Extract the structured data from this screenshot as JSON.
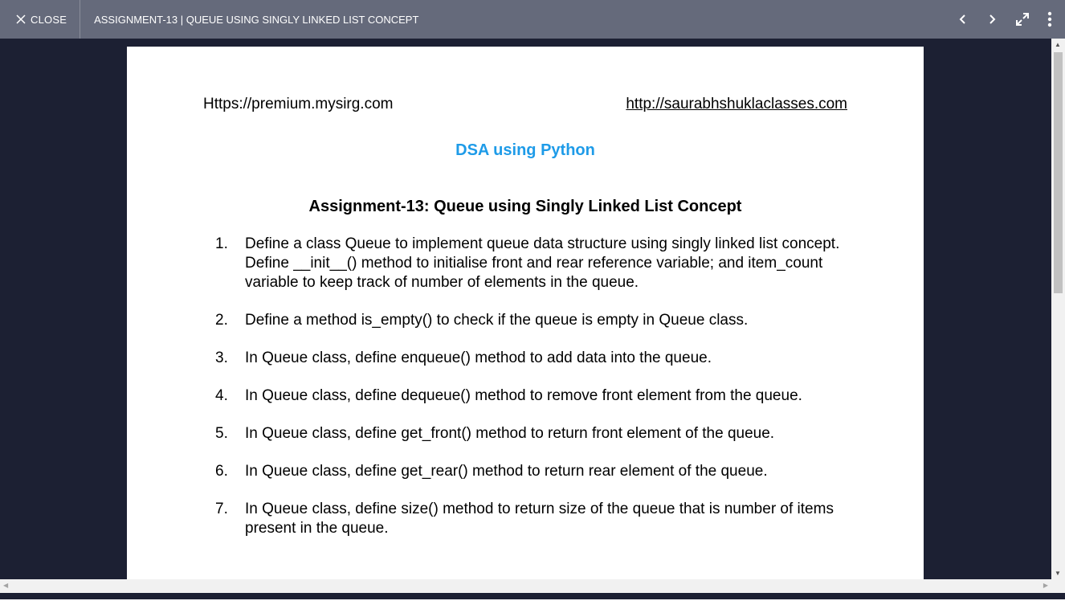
{
  "topbar": {
    "close_label": "CLOSE",
    "title": "ASSIGNMENT-13 | QUEUE USING SINGLY LINKED LIST CONCEPT",
    "icons": [
      "close-icon",
      "chevron-left-icon",
      "chevron-right-icon",
      "expand-icon",
      "more-vert-icon"
    ]
  },
  "document": {
    "header_left": "Https://premium.mysirg.com",
    "header_right": "http://saurabhshuklaclasses.com",
    "course_title": "DSA using Python",
    "assignment_title": "Assignment-13: Queue using Singly Linked List Concept",
    "items": [
      {
        "num": "1.",
        "text": "Define a class Queue to implement queue data structure using singly linked list concept. Define __init__() method to initialise front and rear reference variable; and item_count variable to keep track of number of elements in the queue."
      },
      {
        "num": "2.",
        "text": "Define a method is_empty() to check if the queue is empty in Queue class."
      },
      {
        "num": "3.",
        "text": "In Queue class, define enqueue() method to add data into the queue."
      },
      {
        "num": "4.",
        "text": "In Queue class, define dequeue() method to remove front element from the queue."
      },
      {
        "num": "5.",
        "text": "In Queue class, define get_front() method to return front element of the queue."
      },
      {
        "num": "6.",
        "text": "In Queue class, define get_rear() method to return rear element of the queue."
      },
      {
        "num": "7.",
        "text": "In Queue class, define size() method to return size of the queue that is number of items present in the queue."
      }
    ]
  },
  "colors": {
    "topbar": "#656a7b",
    "viewer_bg": "#1c2033",
    "course_title": "#1e9be8"
  }
}
